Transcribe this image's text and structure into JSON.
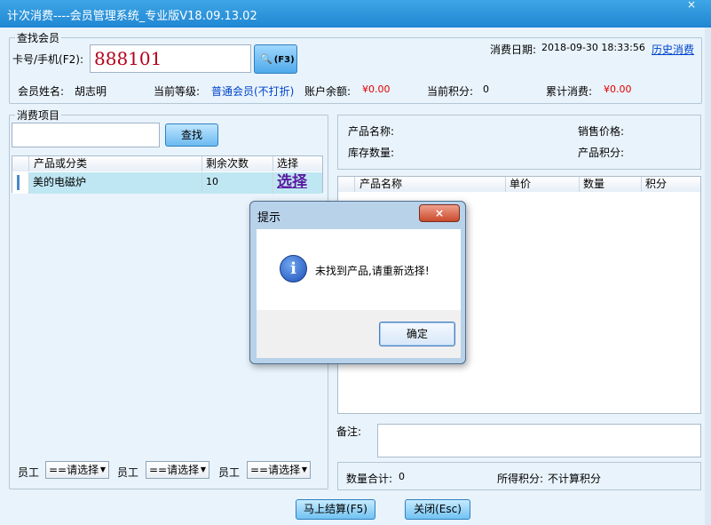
{
  "window": {
    "title": "计次消费----会员管理系统_专业版V18.09.13.02",
    "close_icon": "×"
  },
  "member_group": {
    "legend": "查找会员",
    "card_label": "卡号/手机(F2):",
    "card_value": "888101",
    "search_btn": "(F3)",
    "date_label": "消费日期:",
    "date_value": "2018-09-30 18:33:56",
    "history_link": "历史消费",
    "name_label": "会员姓名:",
    "name_value": "胡志明",
    "level_label": "当前等级:",
    "level_value": "普通会员(不打折)",
    "balance_label": "账户余额:",
    "balance_value": "¥0.00",
    "points_label": "当前积分:",
    "points_value": "0",
    "total_label": "累计消费:",
    "total_value": "¥0.00"
  },
  "items_group": {
    "legend": "消费项目",
    "find_btn": "查找",
    "columns": [
      "产品或分类",
      "剩余次数",
      "选择"
    ],
    "rows": [
      {
        "name": "美的电磁炉",
        "remaining": "10",
        "action": "选择"
      }
    ]
  },
  "product_info": {
    "name_label": "产品名称:",
    "price_label": "销售价格:",
    "stock_label": "库存数量:",
    "points_label": "产品积分:"
  },
  "cart": {
    "columns": [
      "产品名称",
      "单价",
      "数量",
      "积分"
    ]
  },
  "remark_label": "备注:",
  "staff": [
    {
      "label": "员工",
      "value": "==请选择"
    },
    {
      "label": "员工",
      "value": "==请选择"
    },
    {
      "label": "员工",
      "value": "==请选择"
    }
  ],
  "summary": {
    "qty_label": "数量合计:",
    "qty_value": "0",
    "earned_label": "所得积分:",
    "earned_value": "不计算积分"
  },
  "buttons": {
    "checkout": "马上结算(F5)",
    "close": "关闭(Esc)"
  },
  "dialog": {
    "title": "提示",
    "close_icon": "×",
    "info_icon": "i",
    "message": "未找到产品,请重新选择!",
    "ok": "确定"
  },
  "colors": {
    "titlebar": "#2a94dc",
    "body_bg": "#e9f3fb",
    "red_value": "#e00000",
    "blue_link": "#0044cc"
  }
}
